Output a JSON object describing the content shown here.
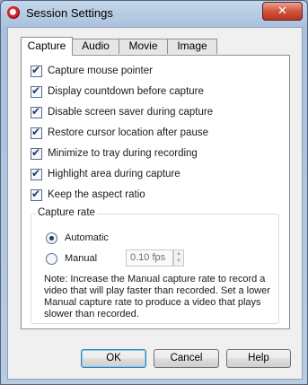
{
  "window": {
    "title": "Session Settings"
  },
  "tabs": [
    {
      "label": "Capture",
      "active": true
    },
    {
      "label": "Audio",
      "active": false
    },
    {
      "label": "Movie",
      "active": false
    },
    {
      "label": "Image",
      "active": false
    }
  ],
  "options": [
    {
      "label": "Capture mouse pointer",
      "checked": true
    },
    {
      "label": "Display countdown before capture",
      "checked": true
    },
    {
      "label": "Disable screen saver during capture",
      "checked": true
    },
    {
      "label": "Restore cursor location after pause",
      "checked": true
    },
    {
      "label": "Minimize to tray during recording",
      "checked": true
    },
    {
      "label": "Highlight area during capture",
      "checked": true
    },
    {
      "label": "Keep the aspect ratio",
      "checked": true
    }
  ],
  "capture_rate": {
    "group_title": "Capture rate",
    "automatic_label": "Automatic",
    "manual_label": "Manual",
    "selected": "Automatic",
    "fps_value": "0.10 fps",
    "note": "Note: Increase the Manual capture rate to record a video that will play faster than recorded. Set a lower Manual capture rate to produce a video that plays slower than recorded."
  },
  "buttons": {
    "ok": "OK",
    "cancel": "Cancel",
    "help": "Help"
  },
  "titlebar": {
    "close_glyph": "✕"
  },
  "glyphs": {
    "check": "✔",
    "spin_up": "▲",
    "spin_down": "▼"
  }
}
